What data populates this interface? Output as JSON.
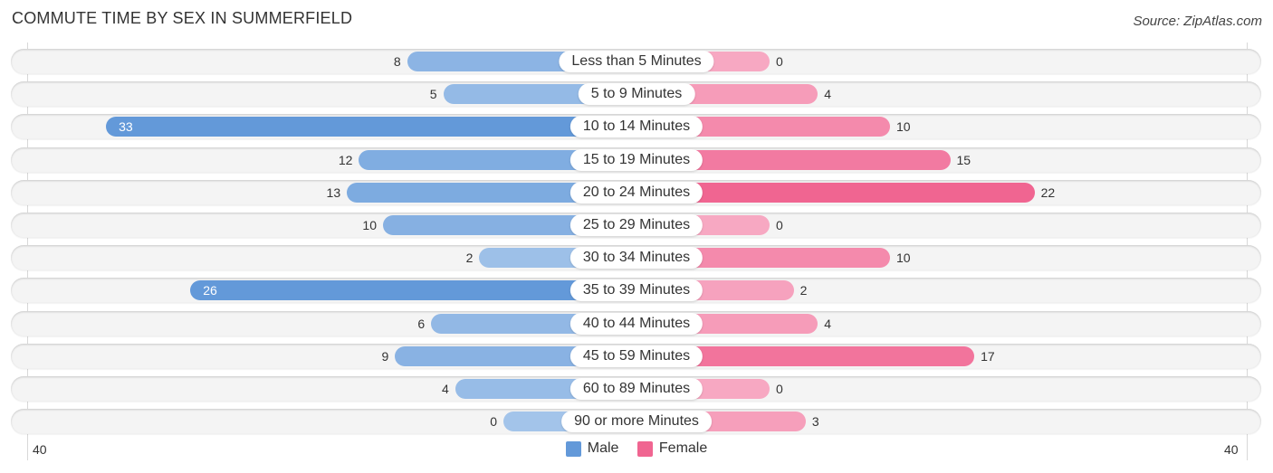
{
  "title": "COMMUTE TIME BY SEX IN SUMMERFIELD",
  "source": "Source: ZipAtlas.com",
  "colors": {
    "male_strong": "#6399d9",
    "male_light": "#a3c4ea",
    "female_strong": "#f06591",
    "female_light": "#f7a8c2"
  },
  "chart_data": {
    "type": "bar",
    "orientation": "horizontal-diverging",
    "title": "COMMUTE TIME BY SEX IN SUMMERFIELD",
    "categories": [
      "Less than 5 Minutes",
      "5 to 9 Minutes",
      "10 to 14 Minutes",
      "15 to 19 Minutes",
      "20 to 24 Minutes",
      "25 to 29 Minutes",
      "30 to 34 Minutes",
      "35 to 39 Minutes",
      "40 to 44 Minutes",
      "45 to 59 Minutes",
      "60 to 89 Minutes",
      "90 or more Minutes"
    ],
    "series": [
      {
        "name": "Male",
        "values": [
          8,
          5,
          33,
          12,
          13,
          10,
          2,
          26,
          6,
          9,
          4,
          0
        ]
      },
      {
        "name": "Female",
        "values": [
          0,
          4,
          10,
          15,
          22,
          0,
          10,
          2,
          4,
          17,
          0,
          3
        ]
      }
    ],
    "axis_ticks": {
      "left": "40",
      "right": "40"
    },
    "xlim": [
      -40,
      40
    ],
    "legend": {
      "placement": "bottom-center",
      "entries": [
        "Male",
        "Female"
      ]
    },
    "grid": false
  }
}
